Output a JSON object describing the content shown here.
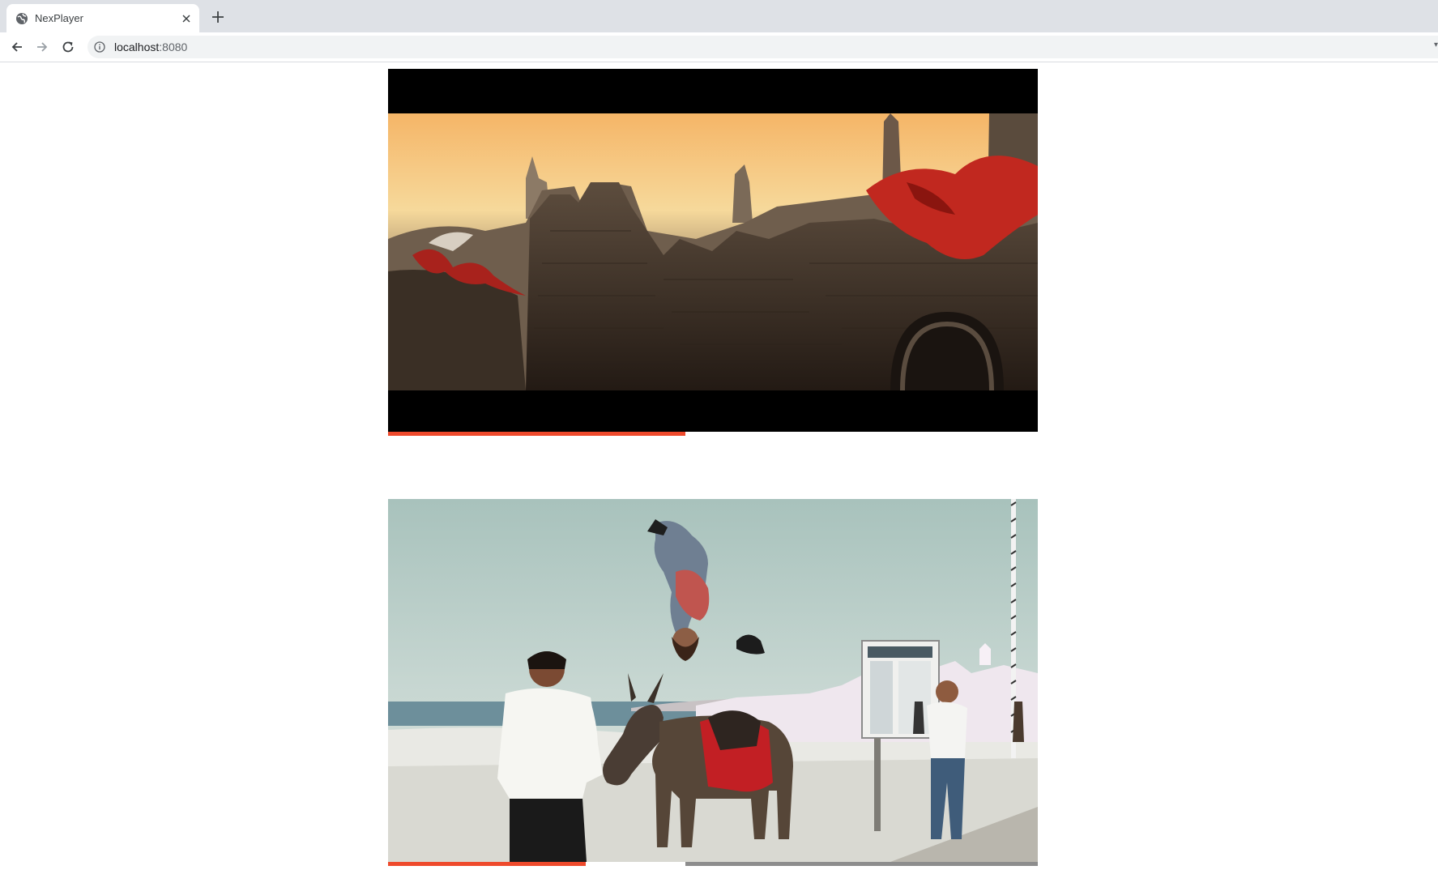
{
  "browser": {
    "tab_title": "NexPlayer",
    "url_host": "localhost",
    "url_port": ":8080",
    "tab_icon": "globe-icon"
  },
  "players": [
    {
      "name": "video-player-1",
      "progress": 0.458,
      "scene": "fantasy city ruins at sunset with red dragons"
    },
    {
      "name": "video-player-2",
      "progress": 0.304,
      "buffered_start": 0.458,
      "buffered_end": 1.0,
      "scene": "man backflipping over a donkey on a whitewashed terrace"
    }
  ],
  "colors": {
    "progress": "#ee4a2c",
    "buffer": "#8d8d8d",
    "tabstrip": "#dee1e6"
  }
}
